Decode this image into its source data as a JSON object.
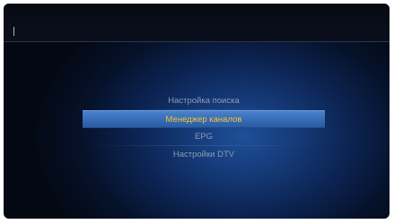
{
  "top_bar": {
    "title": ""
  },
  "menu": {
    "items": [
      {
        "label": "Настройка поиска",
        "selected": false
      },
      {
        "label": "Менеджер каналов",
        "selected": true
      },
      {
        "label": "EPG",
        "selected": false
      },
      {
        "label": "Настройки DTV",
        "selected": false
      }
    ]
  },
  "colors": {
    "background_center": "#1f4f98",
    "background_edge": "#030812",
    "selected_bar": "#3a6fb8",
    "selected_text": "#f2c53a",
    "item_text": "#8e9bb3"
  }
}
